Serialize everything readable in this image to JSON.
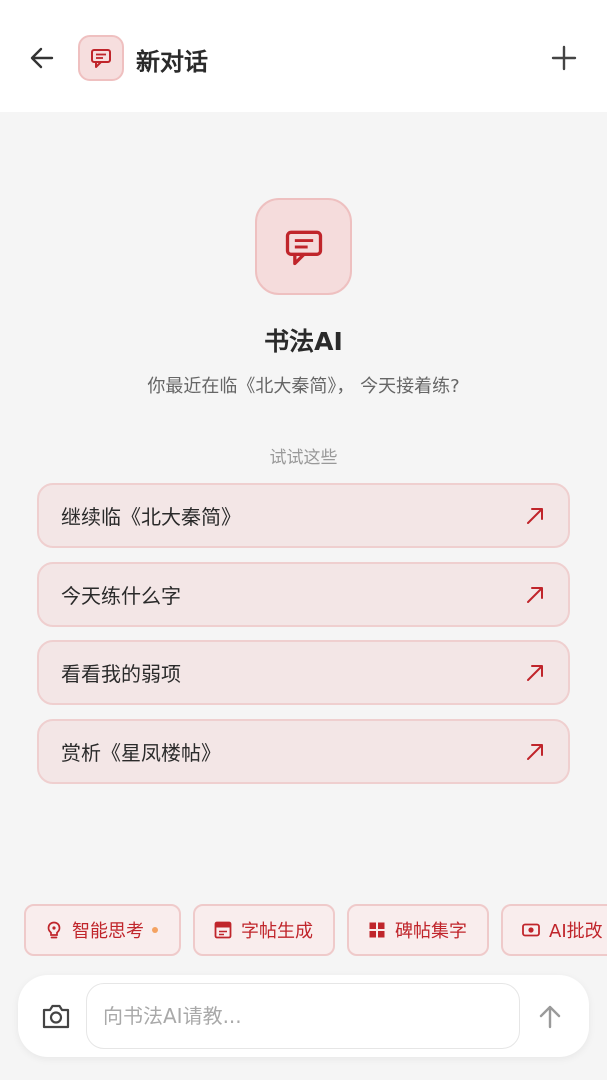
{
  "header": {
    "title": "新对话",
    "back_icon": "arrow-left-icon",
    "avatar_icon": "chat-icon",
    "new_icon": "plus-icon"
  },
  "hero": {
    "icon": "chat-icon",
    "title": "书法AI",
    "subtitle": "你最近在临《北大秦简》， 今天接着练?"
  },
  "suggestions": {
    "label": "试试这些",
    "items": [
      {
        "text": "继续临《北大秦简》"
      },
      {
        "text": "今天练什么字"
      },
      {
        "text": "看看我的弱项"
      },
      {
        "text": "赏析《星凤楼帖》"
      }
    ]
  },
  "tools": [
    {
      "label": "智能思考",
      "icon": "lightbulb-icon",
      "badge": true
    },
    {
      "label": "字帖生成",
      "icon": "copybook-icon"
    },
    {
      "label": "碑帖集字",
      "icon": "grid-icon"
    },
    {
      "label": "AI批改",
      "icon": "review-icon"
    }
  ],
  "composer": {
    "placeholder": "向书法AI请教...",
    "camera_icon": "camera-icon",
    "send_icon": "arrow-up-icon"
  },
  "colors": {
    "accent": "#c0252b",
    "chip_bg": "#f9eded",
    "card_bg": "#f3e6e6",
    "badge": "#f4a261"
  }
}
